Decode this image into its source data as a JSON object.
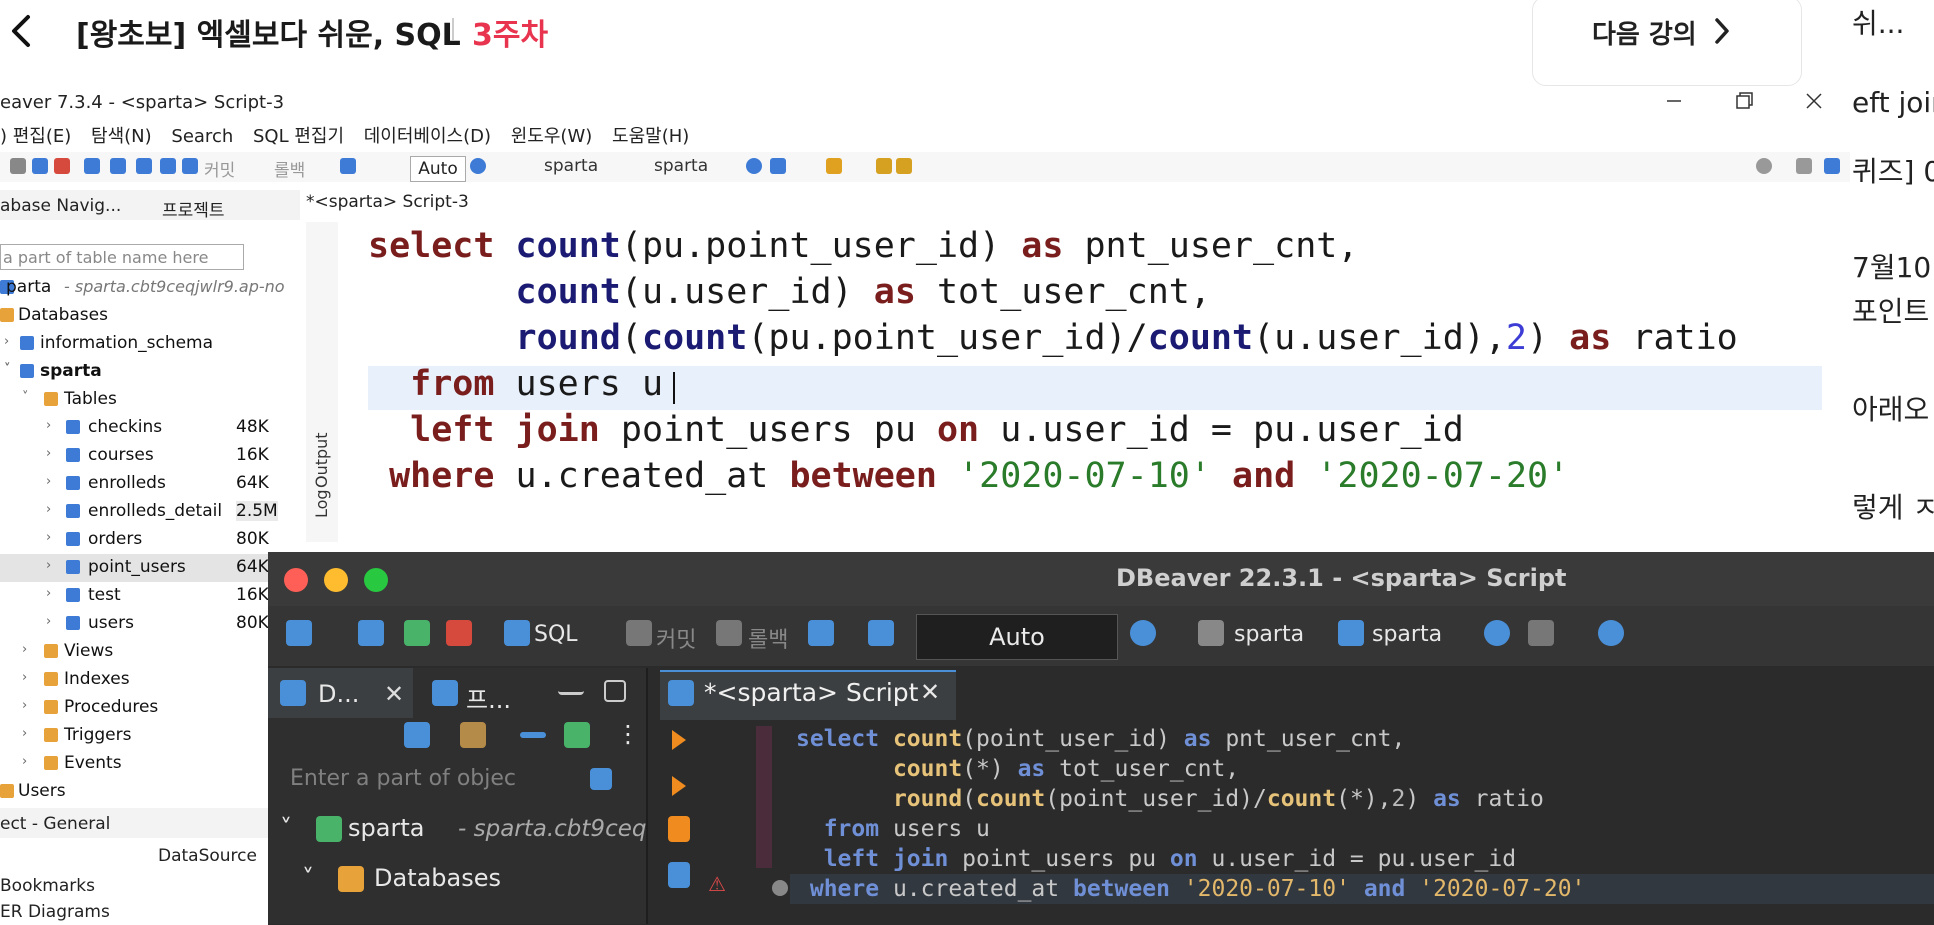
{
  "course": {
    "title": "[왕초보] 엑셀보다 쉬운, SQL",
    "week": "3주차",
    "next_label": "다음 강의"
  },
  "right_page": {
    "lines": [
      "쉬...",
      "eft joir",
      "퀴즈] 0",
      "7월10",
      "포인트",
      "아래오",
      "렇게 ㅈ"
    ]
  },
  "old_dbeaver": {
    "title": "eaver 7.3.4 - <sparta> Script-3",
    "menu": [
      ") 편집(E)",
      "탐색(N)",
      "Search",
      "SQL 편집기",
      "데이터베이스(D)",
      "윈도우(W)",
      "도움말(H)"
    ],
    "toolbar": {
      "commit": "커밋",
      "rollback": "롤백",
      "auto": "Auto",
      "conn1": "sparta",
      "conn2": "sparta"
    },
    "nav_tabs": [
      "abase Navig...",
      "프로젝트"
    ],
    "filter_placeholder": "a part of table name here",
    "tree": {
      "root": "parta",
      "root_sub": "- sparta.cbt9ceqjwlr9.ap-no",
      "databases": "Databases",
      "info_schema": "information_schema",
      "sparta": "sparta",
      "tables": "Tables",
      "table_rows": [
        {
          "name": "checkins",
          "size": "48K"
        },
        {
          "name": "courses",
          "size": "16K"
        },
        {
          "name": "enrolleds",
          "size": "64K"
        },
        {
          "name": "enrolleds_detail",
          "size": "2.5M"
        },
        {
          "name": "orders",
          "size": "80K"
        },
        {
          "name": "point_users",
          "size": "64K"
        },
        {
          "name": "test",
          "size": "16K"
        },
        {
          "name": "users",
          "size": "80K"
        }
      ],
      "folders": [
        "Views",
        "Indexes",
        "Procedures",
        "Triggers",
        "Events"
      ],
      "users": "Users"
    },
    "bottom": {
      "tab": "ect - General",
      "col": "DataSource",
      "items": [
        "Bookmarks",
        "ER Diagrams"
      ]
    },
    "editor_tab": "*<sparta> Script-3",
    "side_labels": {
      "output": "Output",
      "log": "Log"
    }
  },
  "new_dbeaver": {
    "title": "DBeaver 22.3.1 - <sparta> Script",
    "toolbar": {
      "sql": "SQL",
      "commit": "커밋",
      "rollback": "롤백",
      "auto": "Auto",
      "conn1": "sparta",
      "conn2": "sparta"
    },
    "nav_tabs": [
      "D...",
      "프..."
    ],
    "filter_placeholder": "Enter a part of objec",
    "tree": {
      "root": "sparta",
      "root_sub": "- sparta.cbt9ceq",
      "databases": "Databases"
    },
    "editor_tab": "*<sparta> Script"
  },
  "colors": {
    "accent_red": "#e8344e",
    "dark_bg": "#2b2b2b",
    "keyword_old": "#7a1d1d",
    "keyword_new": "#6f8fd6"
  }
}
